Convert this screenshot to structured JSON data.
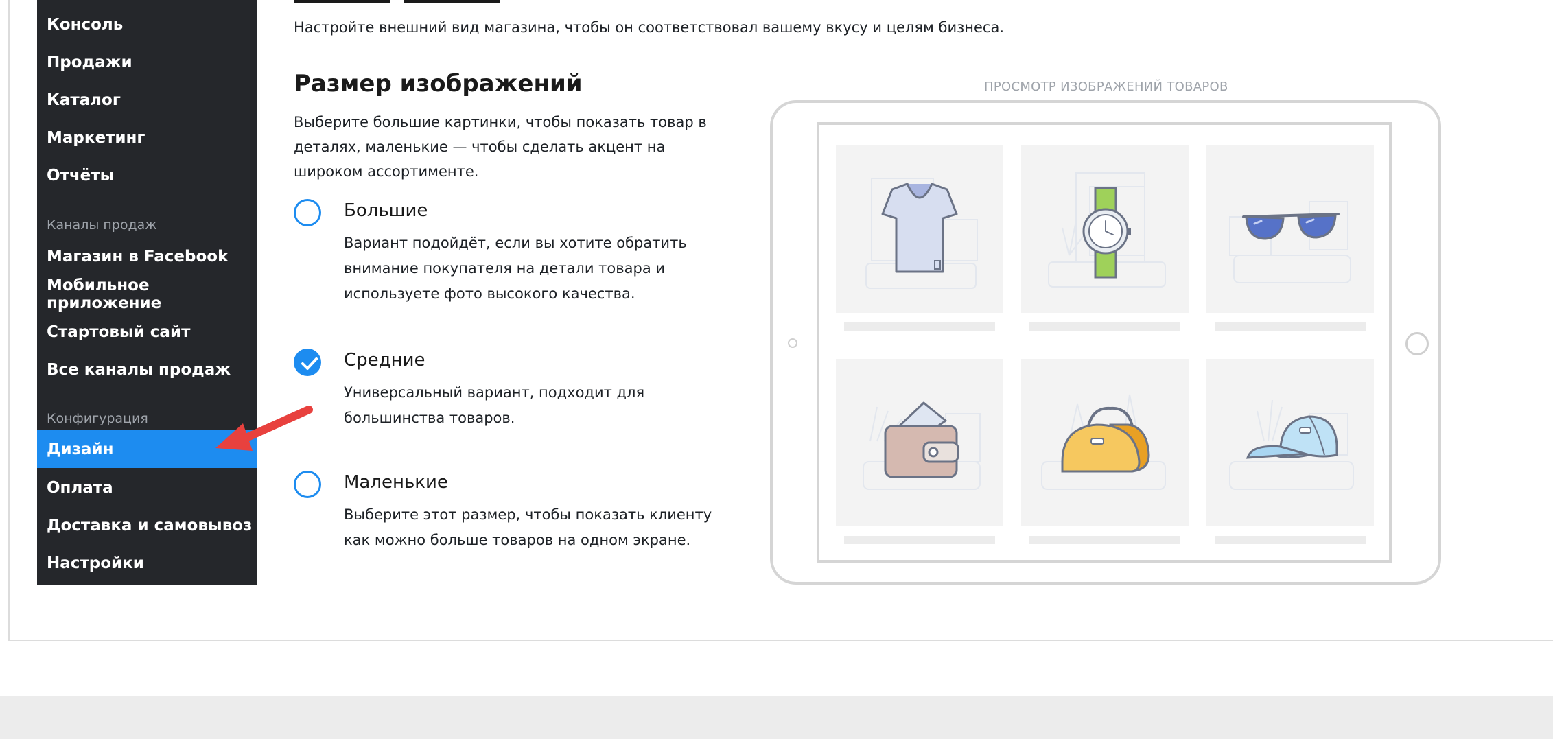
{
  "sidebar": {
    "items_top": [
      {
        "label": "Консоль"
      },
      {
        "label": "Продажи"
      },
      {
        "label": "Каталог"
      },
      {
        "label": "Маркетинг"
      },
      {
        "label": "Отчёты"
      }
    ],
    "section_sales": "Каналы продаж",
    "items_sales": [
      {
        "label": "Магазин в Facebook"
      },
      {
        "label": "Мобильное приложение"
      },
      {
        "label": "Стартовый сайт"
      },
      {
        "label": "Все каналы продаж"
      }
    ],
    "section_config": "Конфигурация",
    "items_config": [
      {
        "label": "Дизайн",
        "active": true
      },
      {
        "label": "Оплата"
      },
      {
        "label": "Доставка и самовывоз"
      },
      {
        "label": "Настройки"
      }
    ]
  },
  "main": {
    "subtitle": "Настройте внешний вид магазина, чтобы он соответствовал вашему вкусу и целям бизнеса.",
    "section_title": "Размер изображений",
    "section_desc": "Выберите большие картинки, чтобы показать товар в деталях, маленькие — чтобы сделать акцент на широком ассортименте.",
    "options": [
      {
        "title": "Большие",
        "desc": "Вариант подойдёт, если вы хотите обратить внимание покупателя на детали товара и используете фото высокого качества.",
        "checked": false
      },
      {
        "title": "Средние",
        "desc": "Универсальный вариант, подходит для большинства товаров.",
        "checked": true
      },
      {
        "title": "Маленькие",
        "desc": "Выберите этот размер, чтобы показать клиенту как можно больше товаров на одном экране.",
        "checked": false
      }
    ]
  },
  "preview": {
    "label": "ПРОСМОТР ИЗОБРАЖЕНИЙ ТОВАРОВ",
    "products": [
      "t-shirt-icon",
      "watch-icon",
      "sunglasses-icon",
      "wallet-icon",
      "bag-icon",
      "cap-icon"
    ]
  },
  "colors": {
    "accent": "#1d8cf0",
    "sidebar_bg": "#25272b",
    "arrow": "#e8413e"
  }
}
